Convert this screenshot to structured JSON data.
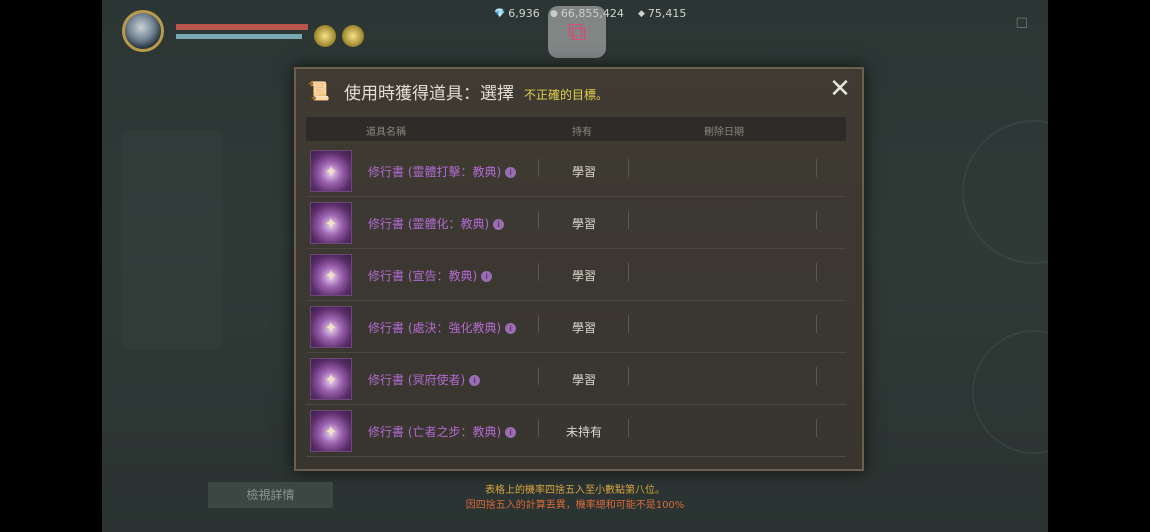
{
  "hud": {
    "res1": "6,936",
    "res2": "66,855,424",
    "res3": "75,415"
  },
  "modal": {
    "title": "使用時獲得道具：選擇",
    "warning": "不正確的目標。",
    "columns": [
      "道具名稱",
      "持有",
      "刪除日期"
    ],
    "rows": [
      {
        "name": "修行書 (靈體打擊：教典)",
        "status": "學習"
      },
      {
        "name": "修行書 (靈體化：教典)",
        "status": "學習"
      },
      {
        "name": "修行書 (宣告：教典)",
        "status": "學習"
      },
      {
        "name": "修行書 (處決：強化教典)",
        "status": "學習"
      },
      {
        "name": "修行書 (冥府使者)",
        "status": "學習"
      },
      {
        "name": "修行書 (亡者之步：教典)",
        "status": "未持有"
      }
    ]
  },
  "footer": {
    "note1": "表格上的機率四捨五入至小數點第八位。",
    "note2": "因四捨五入的計算丟異，機率總和可能不是100%",
    "left_button": "檢視詳情"
  },
  "colors": {
    "title": "#e2ddd3",
    "warning": "#e2cf4e",
    "item_name": "#b16ad0",
    "note1": "#d9a63f",
    "note2": "#d96a3a"
  },
  "icons": {
    "close": "close-icon",
    "scroll": "scroll-icon",
    "item": "book-emblem-icon",
    "cast": "screen-cast-icon"
  }
}
